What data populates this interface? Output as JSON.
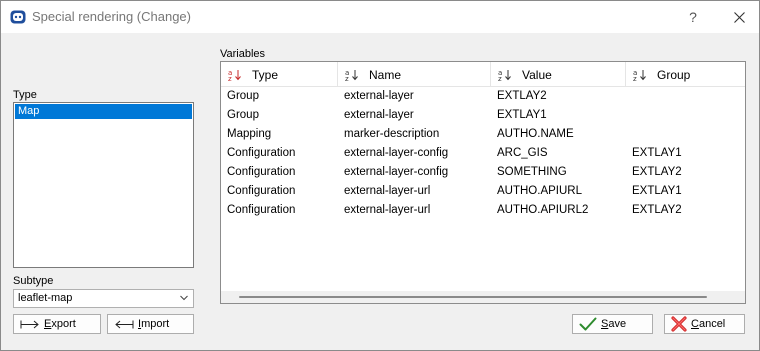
{
  "window": {
    "title": "Special rendering (Change)",
    "help_label": "?"
  },
  "type_section": {
    "label": "Type",
    "items": [
      "Map"
    ],
    "selected": "Map"
  },
  "subtype_section": {
    "label": "Subtype",
    "value": "leaflet-map"
  },
  "buttons": {
    "export_prefix": "",
    "export_underline": "E",
    "export_rest": "xport",
    "import_underline": "I",
    "import_rest": "mport",
    "save_underline": "S",
    "save_rest": "ave",
    "cancel_underline": "C",
    "cancel_rest": "ancel"
  },
  "variables": {
    "label": "Variables",
    "columns": [
      "Type",
      "Name",
      "Value",
      "Group"
    ],
    "rows": [
      [
        "Group",
        "external-layer",
        "EXTLAY2",
        ""
      ],
      [
        "Group",
        "external-layer",
        "EXTLAY1",
        ""
      ],
      [
        "Mapping",
        "marker-description",
        "AUTHO.NAME",
        ""
      ],
      [
        "Configuration",
        "external-layer-config",
        "ARC_GIS",
        "EXTLAY1"
      ],
      [
        "Configuration",
        "external-layer-config",
        "SOMETHING",
        "EXTLAY2"
      ],
      [
        "Configuration",
        "external-layer-url",
        "AUTHO.APIURL",
        "EXTLAY1"
      ],
      [
        "Configuration",
        "external-layer-url",
        "AUTHO.APIURL2",
        "EXTLAY2"
      ]
    ]
  },
  "colors": {
    "selection": "#0078d7",
    "sort_icon_active": "#c62828",
    "save_check": "#2e8b2e",
    "cancel_x": "#d32f2f"
  },
  "icons": {
    "app": "app-logo-icon",
    "help": "help-icon",
    "close": "close-icon",
    "sort": "sort-ascending-icon",
    "export": "export-arrow-icon",
    "import": "import-arrow-icon",
    "save": "checkmark-icon",
    "cancel": "cancel-x-icon",
    "dropdown": "chevron-down-icon"
  }
}
